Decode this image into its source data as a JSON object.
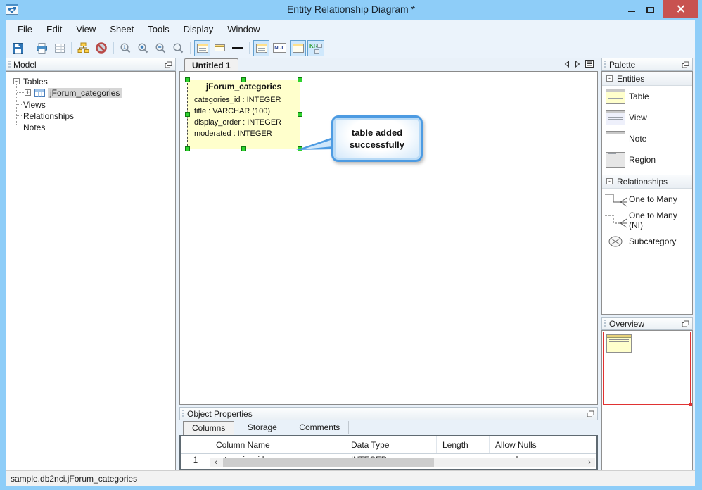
{
  "window": {
    "title": "Entity Relationship Diagram *"
  },
  "menu": {
    "items": [
      "File",
      "Edit",
      "View",
      "Sheet",
      "Tools",
      "Display",
      "Window"
    ]
  },
  "toolbar": {
    "zoom_actual_label": "1",
    "nul_label": "NUL",
    "kr_label": "KR",
    "buttons": [
      "save",
      "print",
      "page-grid",
      "auto-layout",
      "delete-disabled",
      "zoom-actual",
      "zoom-in",
      "zoom-out",
      "zoom",
      "show-attributes",
      "show-compact",
      "show-line",
      "show-columns",
      "show-nullable",
      "show-header",
      "show-keys"
    ]
  },
  "ui": {
    "collapse_glyph": "-",
    "expand_glyph": "+"
  },
  "model_panel": {
    "title": "Model",
    "tree": {
      "tables": "Tables",
      "table_child": "jForum_categories",
      "views": "Views",
      "relationships": "Relationships",
      "notes": "Notes"
    }
  },
  "sheet": {
    "tab": "Untitled 1",
    "entity": {
      "name": "jForum_categories",
      "fields": [
        "categories_id : INTEGER",
        "title : VARCHAR (100)",
        "display_order : INTEGER",
        "moderated : INTEGER"
      ]
    },
    "callout": {
      "line1": "table added",
      "line2": "successfully"
    }
  },
  "palette": {
    "title": "Palette",
    "sections": [
      {
        "label": "Entities",
        "items": [
          {
            "label": "Table"
          },
          {
            "label": "View"
          },
          {
            "label": "Note"
          },
          {
            "label": "Region"
          }
        ]
      },
      {
        "label": "Relationships",
        "items": [
          {
            "label": "One to Many"
          },
          {
            "label": "One to Many (NI)"
          },
          {
            "label": "Subcategory"
          }
        ]
      }
    ]
  },
  "overview": {
    "title": "Overview"
  },
  "properties": {
    "title": "Object Properties",
    "tabs": [
      "Columns",
      "Storage",
      "Comments"
    ],
    "grid": {
      "headers": [
        "Column Name",
        "Data Type",
        "Length",
        "Allow Nulls"
      ],
      "rows": [
        {
          "num": "1",
          "name": "categories_id",
          "type": "INTEGER",
          "length": "",
          "allow_nulls": false
        }
      ]
    }
  },
  "statusbar": {
    "text": "sample.db2nci.jForum_categories"
  },
  "colors": {
    "titlebar": "#8ecdf8",
    "close_button": "#c85250",
    "menu_bg": "#ebf3fb",
    "panel_bg": "#e9f1f9",
    "entity_fill": "#ffffcc",
    "selection_handle": "#2fd32f",
    "callout_border": "#4d9be2",
    "overview_viewport": "#e03232",
    "toolbar_selected_bg": "#cfe8fc",
    "toolbar_selected_border": "#64a1cf",
    "tree_selection": "#d6d6d6"
  }
}
